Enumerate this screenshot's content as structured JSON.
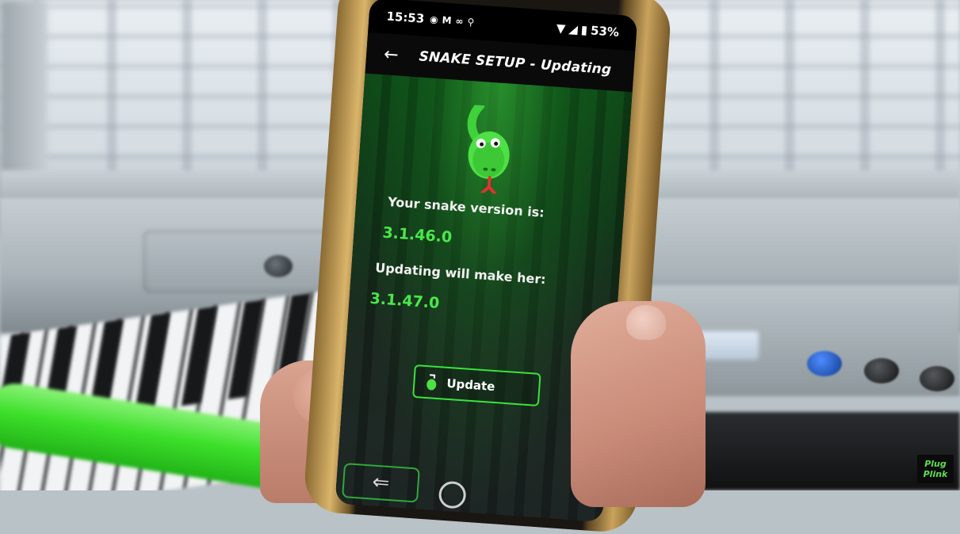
{
  "status_bar": {
    "time": "15:53",
    "battery": "53%",
    "icons": [
      "whatsapp-icon",
      "gmail-icon",
      "voicemail-icon",
      "notification-icon"
    ],
    "right_icons": [
      "wifi-icon",
      "signal-icon",
      "battery-icon"
    ]
  },
  "app_bar": {
    "title": "SNAKE SETUP - Updating"
  },
  "content": {
    "current_label": "Your snake version is:",
    "current_version": "3.1.46.0",
    "next_label": "Updating will make her:",
    "next_version": "3.1.47.0",
    "update_button": "Update"
  },
  "nav": {
    "back_glyph": "⇐"
  },
  "watermark": {
    "line1": "Plug",
    "line2": "Plink"
  },
  "colors": {
    "accent_green": "#39e43a",
    "version_green": "#49e84a",
    "tube_green": "#3ee02b"
  }
}
